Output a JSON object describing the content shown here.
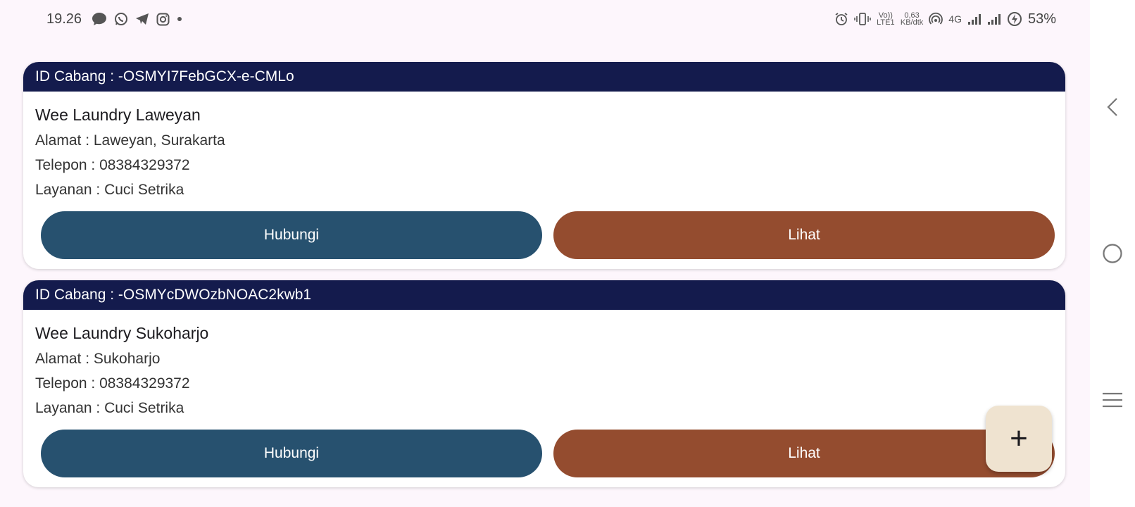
{
  "status_bar": {
    "time": "19.26",
    "left_icons": [
      "chat-bubble-icon",
      "whatsapp-icon",
      "telegram-icon",
      "instagram-icon",
      "dot-icon"
    ],
    "volte_label": "Vo)) LTE1",
    "net_speed_value": "0,63",
    "net_speed_unit": "KB/dtk",
    "network_type": "4G",
    "battery": "53%"
  },
  "branches": [
    {
      "id_text": "ID Cabang : -OSMYI7FebGCX-e-CMLo",
      "name": "Wee Laundry Laweyan",
      "address": "Alamat : Laweyan, Surakarta",
      "phone": "Telepon : 08384329372",
      "service": "Layanan : Cuci Setrika",
      "contact_label": "Hubungi",
      "view_label": "Lihat"
    },
    {
      "id_text": "ID Cabang : -OSMYcDWOzbNOAC2kwb1",
      "name": "Wee Laundry Sukoharjo",
      "address": "Alamat : Sukoharjo",
      "phone": "Telepon : 08384329372",
      "service": "Layanan : Cuci Setrika",
      "contact_label": "Hubungi",
      "view_label": "Lihat"
    }
  ],
  "fab": {
    "icon": "plus-icon",
    "label": "+"
  },
  "nav_bar": {
    "buttons": [
      "back-icon",
      "home-icon",
      "recents-icon"
    ]
  },
  "colors": {
    "background": "#fdf6fc",
    "card_header": "#141b4d",
    "contact_button": "#27516f",
    "view_button": "#944c2f",
    "fab": "#efe3d0"
  }
}
